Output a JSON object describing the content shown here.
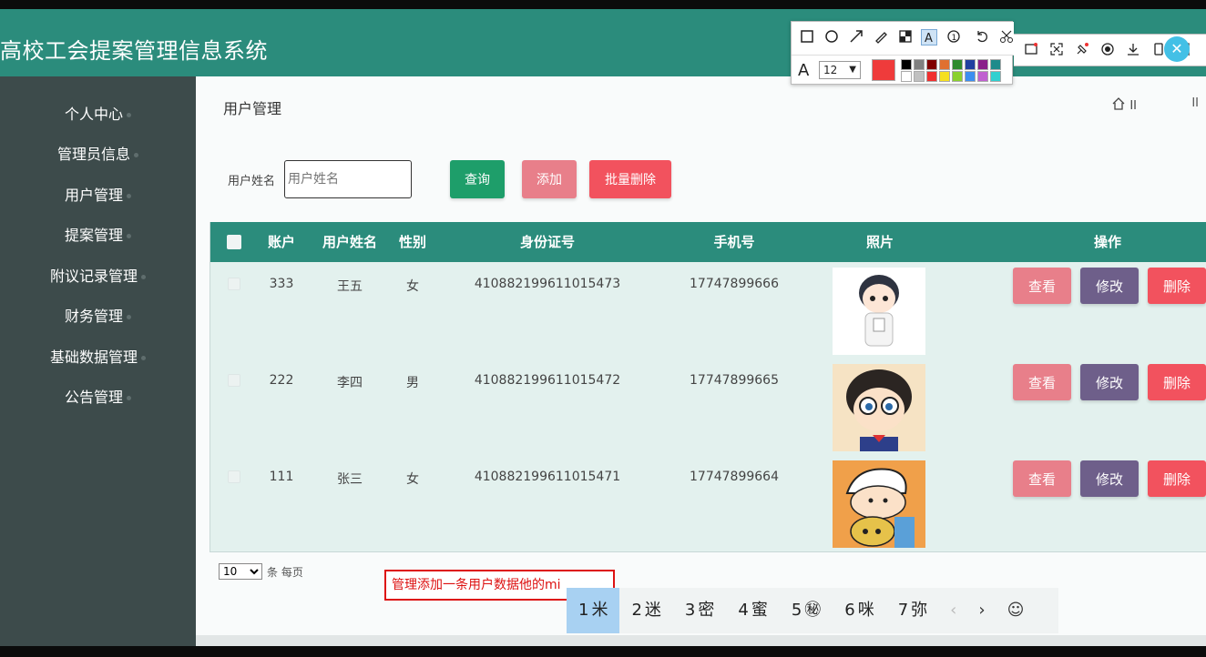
{
  "header": {
    "title": "高校工会提案管理信息系统"
  },
  "sidebar": {
    "items": [
      {
        "label": "个人中心"
      },
      {
        "label": "管理员信息"
      },
      {
        "label": "用户管理"
      },
      {
        "label": "提案管理"
      },
      {
        "label": "附议记录管理"
      },
      {
        "label": "财务管理"
      },
      {
        "label": "基础数据管理"
      },
      {
        "label": "公告管理"
      }
    ]
  },
  "main": {
    "title": "用户管理",
    "breadcrumb_sep": "II",
    "breadcrumb_sep2": "II"
  },
  "search": {
    "label": "用户姓名",
    "placeholder": "用户姓名",
    "query_label": "查询",
    "add_label": "添加",
    "batch_delete_label": "批量删除"
  },
  "table": {
    "headers": {
      "account": "账户",
      "name": "用户姓名",
      "gender": "性别",
      "id_card": "身份证号",
      "phone": "手机号",
      "photo": "照片",
      "actions": "操作"
    },
    "rows": [
      {
        "account": "333",
        "name": "王五",
        "gender": "女",
        "id_card": "410882199611015473",
        "phone": "17747899666",
        "avatar": "boy-avatar"
      },
      {
        "account": "222",
        "name": "李四",
        "gender": "男",
        "id_card": "410882199611015472",
        "phone": "17747899665",
        "avatar": "conan-avatar"
      },
      {
        "account": "111",
        "name": "张三",
        "gender": "女",
        "id_card": "410882199611015471",
        "phone": "17747899664",
        "avatar": "shinchan-avatar"
      }
    ],
    "view_label": "查看",
    "edit_label": "修改",
    "delete_label": "删除"
  },
  "pager": {
    "page_size": "10",
    "per_page_text": "条 每页"
  },
  "ime": {
    "composition": "管理添加一条用户数据他的mi",
    "candidates": [
      {
        "n": "1",
        "c": "米"
      },
      {
        "n": "2",
        "c": "迷"
      },
      {
        "n": "3",
        "c": "密"
      },
      {
        "n": "4",
        "c": "蜜"
      },
      {
        "n": "5",
        "c": "㊙"
      },
      {
        "n": "6",
        "c": "咪"
      },
      {
        "n": "7",
        "c": "弥"
      }
    ],
    "prev": "‹",
    "next": "›",
    "emoji": "☺"
  },
  "annotation_toolbar": {
    "font_size": "12",
    "current_color": "#ef3b3b"
  },
  "colors": {
    "header": "#2b8c7c",
    "sidebar": "#3d4b4b",
    "query": "#1e9e6a",
    "view": "#e87f8a",
    "edit": "#6e5f8a",
    "delete": "#f2525e"
  }
}
